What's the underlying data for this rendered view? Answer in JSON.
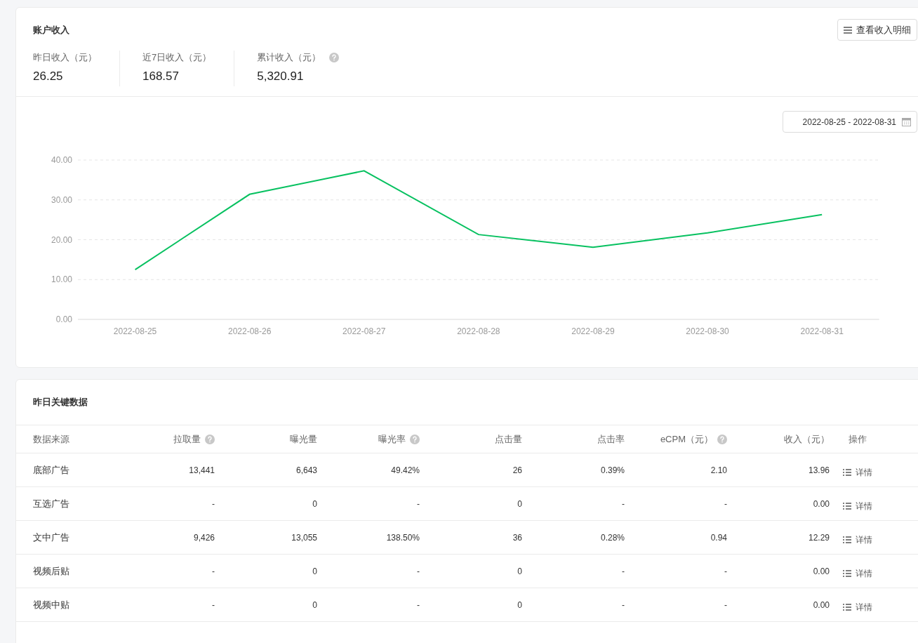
{
  "income_card": {
    "title": "账户收入",
    "detail_button": "查看收入明细",
    "stats": [
      {
        "label": "昨日收入（元）",
        "value": "26.25",
        "help": false
      },
      {
        "label": "近7日收入（元）",
        "value": "168.57",
        "help": false
      },
      {
        "label": "累计收入（元）",
        "value": "5,320.91",
        "help": true
      }
    ],
    "date_range": "2022-08-25 - 2022-08-31",
    "chart_data": {
      "type": "line",
      "categories": [
        "2022-08-25",
        "2022-08-26",
        "2022-08-27",
        "2022-08-28",
        "2022-08-29",
        "2022-08-30",
        "2022-08-31"
      ],
      "grid": true,
      "series": [
        {
          "color": "#07c160",
          "values": [
            12.5,
            31.4,
            37.3,
            21.3,
            18.1,
            21.7,
            26.3
          ]
        }
      ],
      "ylim": [
        0,
        40
      ],
      "yticks": [
        {
          "value": 0,
          "label": "0.00"
        },
        {
          "value": 10,
          "label": "10.00"
        },
        {
          "value": 20,
          "label": "20.00"
        },
        {
          "value": 30,
          "label": "30.00"
        },
        {
          "value": 40,
          "label": "40.00"
        }
      ]
    }
  },
  "key_data_card": {
    "title": "昨日关键数据",
    "table": {
      "columns": [
        {
          "label": "数据来源",
          "help": false
        },
        {
          "label": "拉取量",
          "help": true
        },
        {
          "label": "曝光量",
          "help": false
        },
        {
          "label": "曝光率",
          "help": true
        },
        {
          "label": "点击量",
          "help": false
        },
        {
          "label": "点击率",
          "help": false
        },
        {
          "label": "eCPM（元）",
          "help": true
        },
        {
          "label": "收入（元）",
          "help": false
        },
        {
          "label": "操作",
          "help": false
        }
      ],
      "rows": [
        {
          "cells": [
            "底部广告",
            "13,441",
            "6,643",
            "49.42%",
            "26",
            "0.39%",
            "2.10",
            "13.96"
          ],
          "action": "详情"
        },
        {
          "cells": [
            "互选广告",
            "-",
            "0",
            "-",
            "0",
            "-",
            "-",
            "0.00"
          ],
          "action": "详情"
        },
        {
          "cells": [
            "文中广告",
            "9,426",
            "13,055",
            "138.50%",
            "36",
            "0.28%",
            "0.94",
            "12.29"
          ],
          "action": "详情"
        },
        {
          "cells": [
            "视频后贴",
            "-",
            "0",
            "-",
            "0",
            "-",
            "-",
            "0.00"
          ],
          "action": "详情"
        },
        {
          "cells": [
            "视频中贴",
            "-",
            "0",
            "-",
            "0",
            "-",
            "-",
            "0.00"
          ],
          "action": "详情"
        }
      ]
    }
  }
}
